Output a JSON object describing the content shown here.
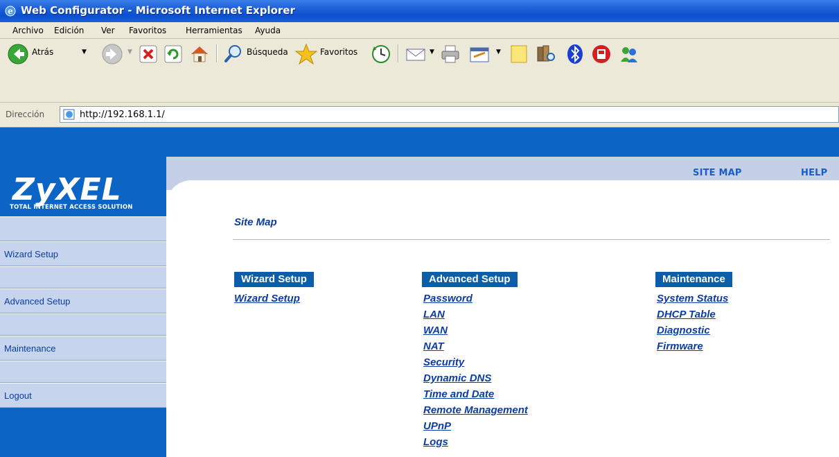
{
  "window": {
    "title": "Web Configurator - Microsoft Internet Explorer"
  },
  "menu": [
    "Archivo",
    "Edición",
    "Ver",
    "Favoritos",
    "Herramientas",
    "Ayuda"
  ],
  "toolbar": {
    "back_label": "Atrás",
    "search_label": "Búsqueda",
    "favorites_label": "Favoritos"
  },
  "address": {
    "label": "Dirección",
    "url": "http://192.168.1.1/"
  },
  "brand": {
    "logo": "ZyXEL",
    "tagline": "TOTAL INTERNET ACCESS SOLUTION",
    "color": "#0c64c4"
  },
  "sidebar": {
    "items": [
      {
        "label": "Wizard Setup"
      },
      {
        "label": "Advanced Setup"
      },
      {
        "label": "Maintenance"
      },
      {
        "label": "Logout"
      }
    ]
  },
  "toplinks": {
    "site_map": "SITE MAP",
    "help": "HELP"
  },
  "sitemap": {
    "title": "Site Map",
    "sections": [
      {
        "heading": "Wizard Setup",
        "links": [
          "Wizard Setup"
        ]
      },
      {
        "heading": "Advanced Setup",
        "links": [
          "Password",
          "LAN",
          "WAN",
          "NAT",
          "Security",
          "Dynamic DNS",
          "Time and Date",
          "Remote Management",
          "UPnP",
          "Logs"
        ]
      },
      {
        "heading": "Maintenance",
        "links": [
          "System Status",
          "DHCP Table",
          "Diagnostic",
          "Firmware"
        ]
      }
    ]
  }
}
